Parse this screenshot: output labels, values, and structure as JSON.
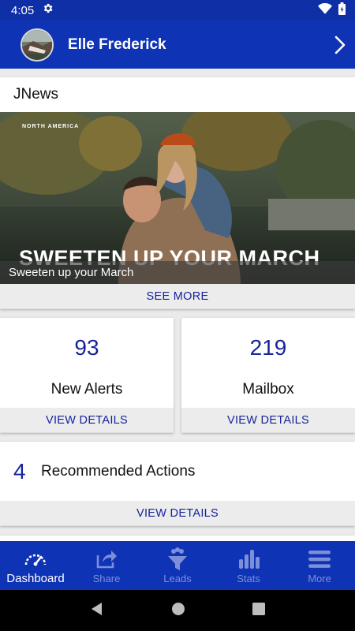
{
  "status_bar": {
    "time": "4:05"
  },
  "header": {
    "user_name": "Elle Frederick"
  },
  "news": {
    "section_title": "JNews",
    "region_label": "NORTH AMERICA",
    "image_headline": "SWEETEN UP YOUR MARCH",
    "caption": "Sweeten up your March",
    "see_more_label": "SEE MORE"
  },
  "stats": [
    {
      "value": "93",
      "label": "New Alerts",
      "action": "VIEW DETAILS"
    },
    {
      "value": "219",
      "label": "Mailbox",
      "action": "VIEW DETAILS"
    }
  ],
  "recommended": {
    "count": "4",
    "label": "Recommended Actions",
    "action": "VIEW DETAILS"
  },
  "bottom_nav": [
    {
      "label": "Dashboard",
      "icon": "speedometer-icon",
      "active": true
    },
    {
      "label": "Share",
      "icon": "share-icon",
      "active": false
    },
    {
      "label": "Leads",
      "icon": "funnel-icon",
      "active": false
    },
    {
      "label": "Stats",
      "icon": "bar-chart-icon",
      "active": false
    },
    {
      "label": "More",
      "icon": "hamburger-icon",
      "active": false
    }
  ],
  "colors": {
    "primary": "#0f33b5",
    "accent_text": "#16249b",
    "inactive_nav": "#7d8fd9"
  }
}
